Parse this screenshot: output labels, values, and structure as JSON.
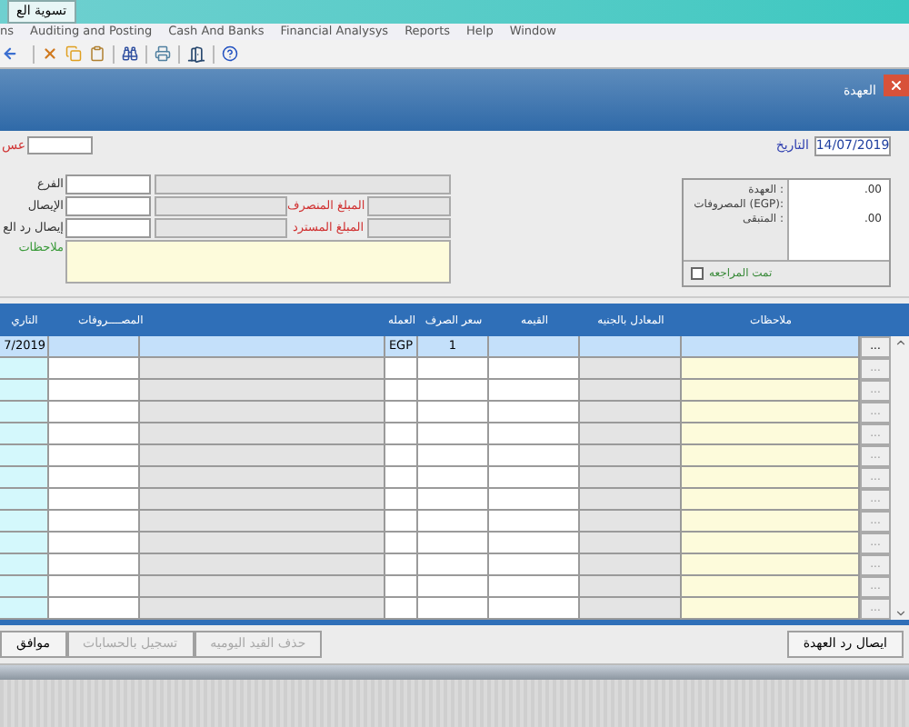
{
  "window": {
    "title": "تسوية الع"
  },
  "menu": [
    "Window",
    "Help",
    "Reports",
    "Financial Analysys",
    "Cash And Banks",
    "Auditing and Posting",
    "ns"
  ],
  "dialog": {
    "title": "العهدة"
  },
  "top_left_label": "عس",
  "date": {
    "label": "التاريخ",
    "value": "14/07/2019"
  },
  "form": {
    "branch_label": "الفرع",
    "receipt_label": "الإيصال",
    "return_receipt_label": "إيصال رد الع",
    "spent_label": "المبلغ المنصرف",
    "refunded_label": "المبلغ المسترد",
    "notes_label": "ملاحظات"
  },
  "summary": {
    "items": [
      {
        "label": ": العهدة",
        "value": ".00"
      },
      {
        "label": ":(EGP) المصروفات"
      },
      {
        "label": ": المتبقى",
        "value": ".00"
      }
    ],
    "reviewed": {
      "label": "تمت المراجعه",
      "checked": false
    }
  },
  "table": {
    "columns": [
      "ملاحظات",
      "المعادل بالجنيه",
      "القيمه",
      "سعر الصرف",
      "العمله",
      "المصــــروفات",
      "التاري"
    ],
    "rows": [
      {
        "selected": true,
        "date": "7/2019",
        "currency": "EGP",
        "rate": "1",
        "more": "..."
      },
      {
        "selected": false,
        "more": "..."
      },
      {
        "selected": false,
        "more": "..."
      },
      {
        "selected": false,
        "more": "..."
      },
      {
        "selected": false,
        "more": "..."
      },
      {
        "selected": false,
        "more": "..."
      },
      {
        "selected": false,
        "more": "..."
      },
      {
        "selected": false,
        "more": "..."
      },
      {
        "selected": false,
        "more": "..."
      },
      {
        "selected": false,
        "more": "..."
      },
      {
        "selected": false,
        "more": "..."
      },
      {
        "selected": false,
        "more": "..."
      },
      {
        "selected": false,
        "more": "..."
      }
    ]
  },
  "buttons": [
    {
      "label": "حذف القيد اليوميه",
      "disabled": true
    },
    {
      "label": "تسجيل بالحسابات",
      "disabled": true
    },
    {
      "label": "موافق",
      "disabled": false
    }
  ],
  "return_button": {
    "label": "ايصال رد العهدة",
    "disabled": false
  }
}
